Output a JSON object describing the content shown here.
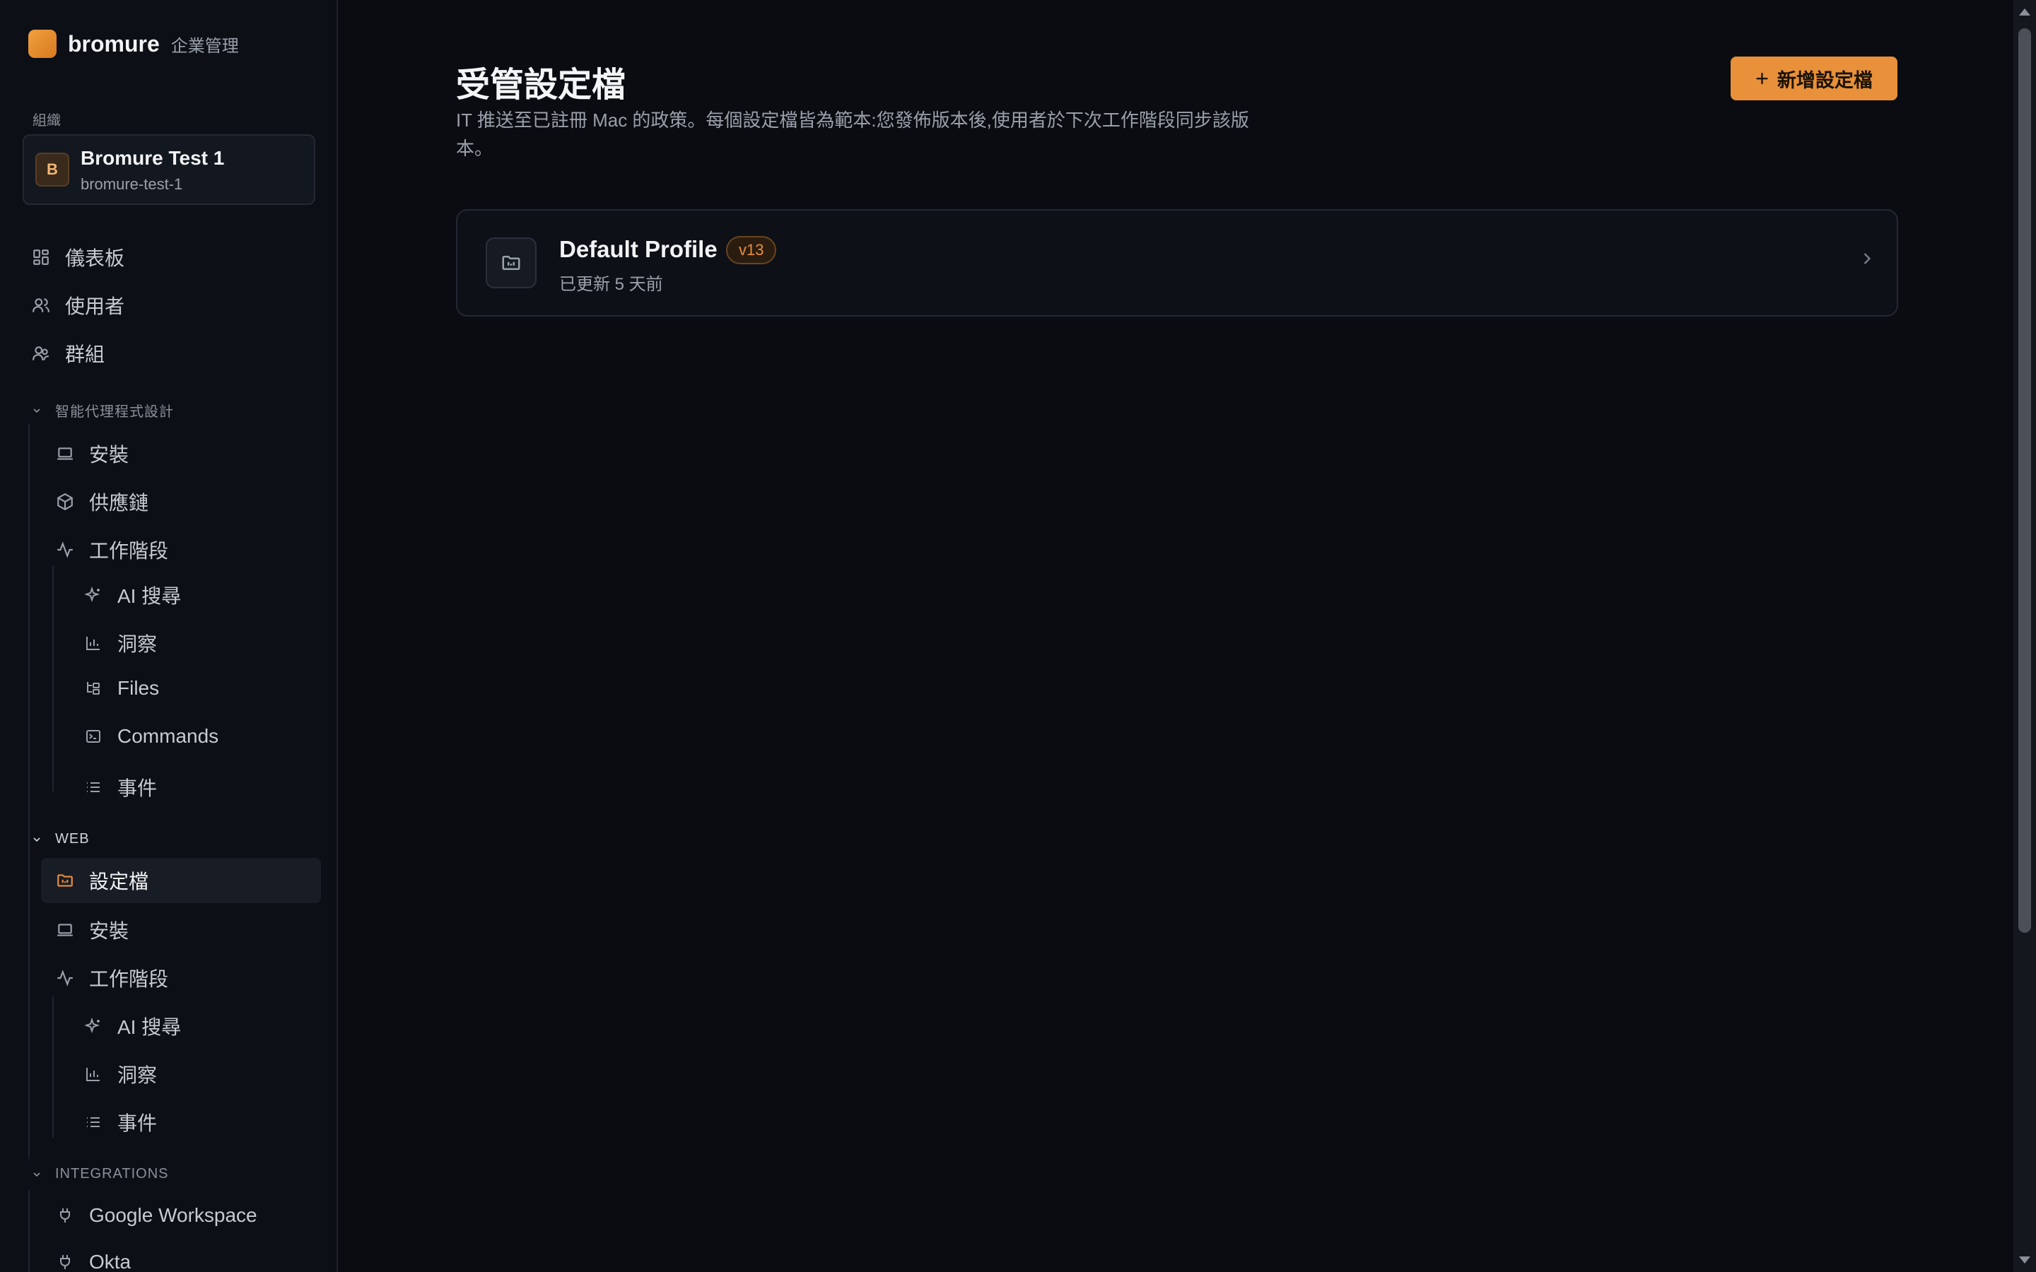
{
  "brand": {
    "name": "bromure",
    "subtitle": "企業管理"
  },
  "org": {
    "section_label": "組織",
    "avatar_letter": "B",
    "name": "Bromure Test 1",
    "slug": "bromure-test-1"
  },
  "nav_top": [
    {
      "label": "儀表板",
      "icon": "dashboard-icon"
    },
    {
      "label": "使用者",
      "icon": "user-icon"
    },
    {
      "label": "群組",
      "icon": "users-icon"
    }
  ],
  "agent_group": {
    "title": "智能代理程式設計",
    "items": [
      {
        "label": "安裝",
        "icon": "laptop-icon"
      },
      {
        "label": "供應鏈",
        "icon": "package-icon"
      },
      {
        "label": "工作階段",
        "icon": "activity-icon"
      }
    ],
    "sub_items": [
      {
        "label": "AI 搜尋",
        "icon": "sparkles-icon"
      },
      {
        "label": "洞察",
        "icon": "bar-chart-icon"
      },
      {
        "label": "Files",
        "icon": "folder-tree-icon"
      },
      {
        "label": "Commands",
        "icon": "terminal-icon"
      },
      {
        "label": "事件",
        "icon": "list-icon"
      }
    ]
  },
  "web_group": {
    "title": "WEB",
    "items": [
      {
        "label": "設定檔",
        "icon": "folder-profile-icon",
        "active": true
      },
      {
        "label": "安裝",
        "icon": "laptop-icon"
      },
      {
        "label": "工作階段",
        "icon": "activity-icon"
      }
    ],
    "sub_items": [
      {
        "label": "AI 搜尋",
        "icon": "sparkles-icon"
      },
      {
        "label": "洞察",
        "icon": "bar-chart-icon"
      },
      {
        "label": "事件",
        "icon": "list-icon"
      }
    ]
  },
  "integrations_group": {
    "title": "INTEGRATIONS",
    "items": [
      {
        "label": "Google Workspace",
        "icon": "plug-icon"
      },
      {
        "label": "Okta",
        "icon": "plug-icon"
      }
    ]
  },
  "page": {
    "title": "受管設定檔",
    "description": "IT 推送至已註冊 Mac 的政策。每個設定檔皆為範本:您發佈版本後,使用者於下次工作階段同步該版本。",
    "new_button_label": "新增設定檔"
  },
  "profiles": [
    {
      "name": "Default Profile",
      "version": "v13",
      "updated": "已更新 5 天前"
    }
  ],
  "colors": {
    "accent": "#e8903a",
    "background": "#0a0c12",
    "sidebar": "#0c0f15"
  }
}
